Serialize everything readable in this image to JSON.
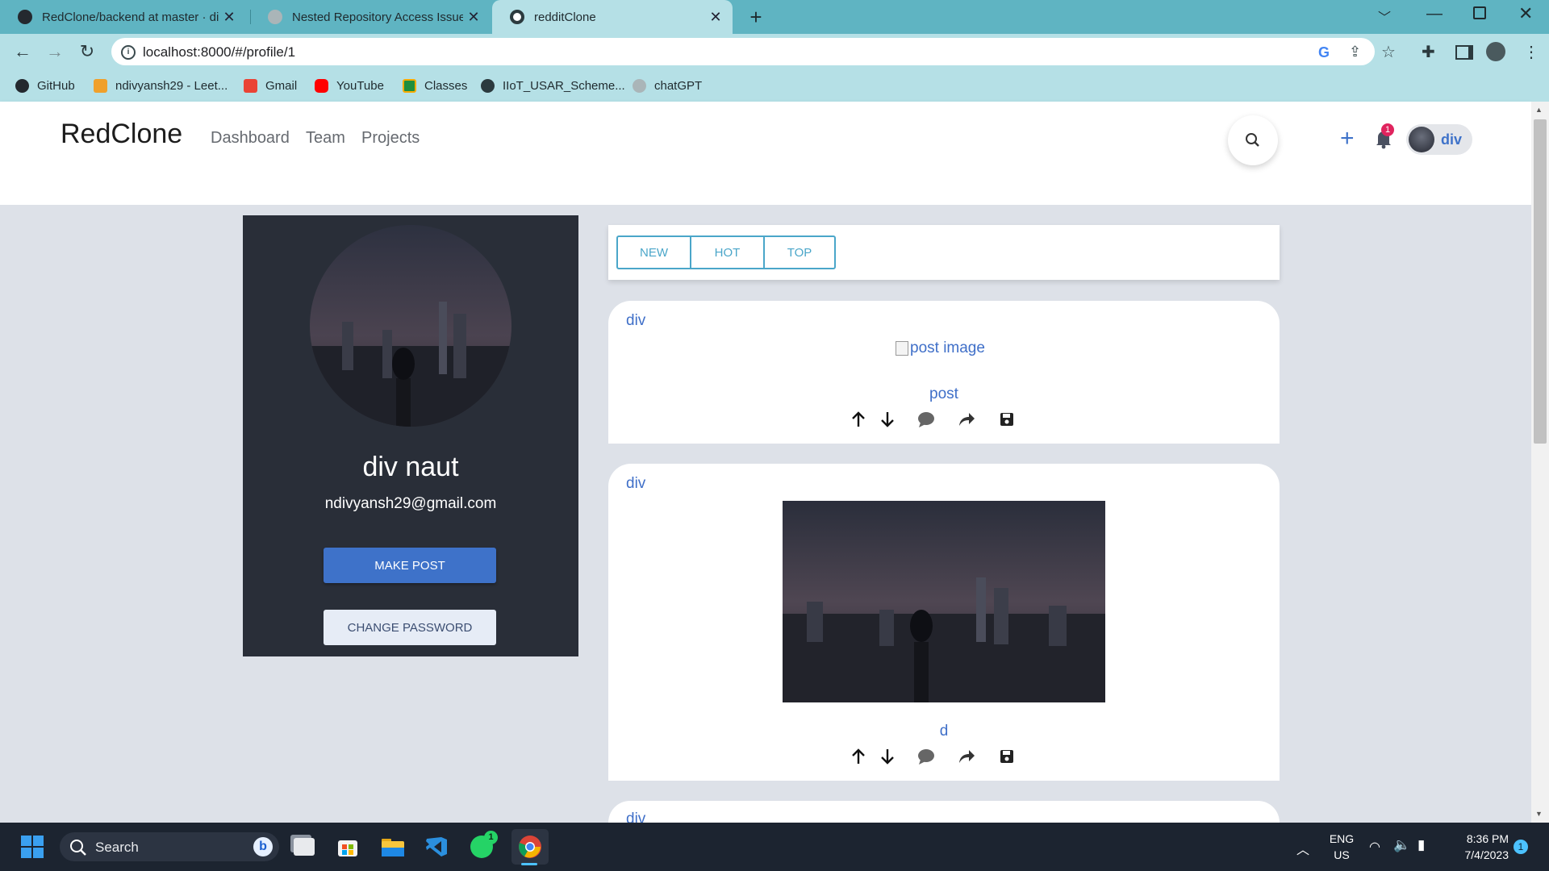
{
  "browser": {
    "tabs": [
      {
        "title": "RedClone/backend at master · di"
      },
      {
        "title": "Nested Repository Access Issue"
      },
      {
        "title": "redditClone",
        "active": true
      }
    ],
    "url": "localhost:8000/#/profile/1",
    "bookmarks": [
      {
        "label": "GitHub",
        "icon": "github-icon"
      },
      {
        "label": "ndivyansh29 - Leet...",
        "icon": "leetcode-icon"
      },
      {
        "label": "Gmail",
        "icon": "gmail-icon"
      },
      {
        "label": "YouTube",
        "icon": "youtube-icon"
      },
      {
        "label": "Classes",
        "icon": "classroom-icon"
      },
      {
        "label": "IIoT_USAR_Scheme...",
        "icon": "globe-icon"
      },
      {
        "label": "chatGPT",
        "icon": "openai-icon"
      }
    ]
  },
  "app": {
    "brand": "RedClone",
    "nav": [
      {
        "label": "Dashboard"
      },
      {
        "label": "Team"
      },
      {
        "label": "Projects"
      }
    ],
    "notification_count": "1",
    "user_chip": "div"
  },
  "profile": {
    "name": "div naut",
    "email": "ndivyansh29@gmail.com",
    "make_post": "MAKE POST",
    "change_password": "CHANGE PASSWORD"
  },
  "sort": [
    {
      "label": "NEW"
    },
    {
      "label": "HOT"
    },
    {
      "label": "TOP"
    }
  ],
  "posts": [
    {
      "author": "div",
      "image_alt": "post image",
      "title": "post"
    },
    {
      "author": "div",
      "title": "d"
    },
    {
      "author": "div"
    }
  ],
  "taskbar": {
    "search": "Search",
    "lang_top": "ENG",
    "lang_bottom": "US",
    "time": "8:36 PM",
    "date": "7/4/2023",
    "whatsapp_badge": "1",
    "notif_badge": "1"
  },
  "colors": {
    "accent": "#3e72c9",
    "chrome": "#5fb4c2",
    "page_bg": "#dde1e8",
    "card_dark": "#292e38"
  }
}
